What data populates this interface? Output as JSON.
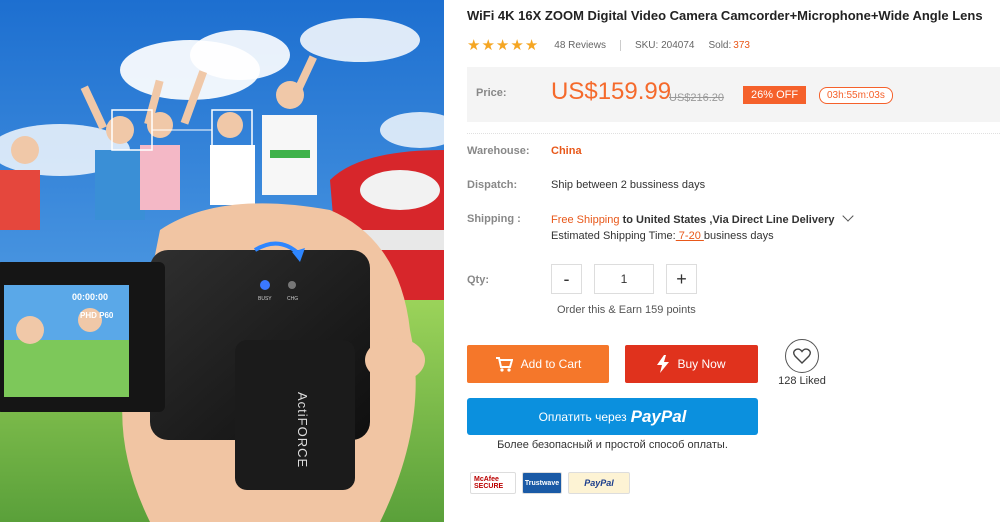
{
  "product": {
    "title": "WiFi 4K 16X ZOOM Digital Video Camera Camcorder+Microphone+Wide Angle Lens",
    "reviews": "48 Reviews",
    "sku": "SKU: 204074",
    "sold_label": "Sold:",
    "sold_value": "373",
    "rating": 5
  },
  "price": {
    "label": "Price:",
    "current": "US$159.99",
    "original": "US$216.20",
    "discount": "26% OFF",
    "countdown": "03h:55m:03s"
  },
  "warehouse": {
    "label": "Warehouse:",
    "value": "China"
  },
  "dispatch": {
    "label": "Dispatch:",
    "value": "Ship between 2 bussiness days"
  },
  "shipping": {
    "label": "Shipping :",
    "free": "Free Shipping",
    "destination": "to United States ,Via Direct Line Delivery",
    "estimate_prefix": "Estimated Shipping Time:",
    "estimate_days": " 7-20 ",
    "estimate_suffix": "business days"
  },
  "quantity": {
    "label": "Qty:",
    "minus": "-",
    "value": "1",
    "plus": "+",
    "points": "Order this & Earn 159 points"
  },
  "actions": {
    "add_to_cart": "Add to Cart",
    "buy_now": "Buy Now",
    "liked": "128 Liked"
  },
  "paypal": {
    "prefix": "Оплатить через",
    "logo": "PayPal",
    "subtitle": "Более безопасный и простой способ оплаты."
  },
  "trust_badges": {
    "mcafee": "McAfee SECURE",
    "trustwave": "Trustwave",
    "paypal": "PayPal"
  },
  "photo": {
    "brand": "ActiFORCE",
    "screen_time": "00:00:00",
    "screen_mode": "PHD P60",
    "led_busy": "BUSY",
    "led_chg": "CHG"
  },
  "colors": {
    "accent": "#f56a2c",
    "buy": "#e0321d",
    "cart": "#f5772a",
    "paypal": "#0b90de",
    "star": "#f5a623"
  }
}
